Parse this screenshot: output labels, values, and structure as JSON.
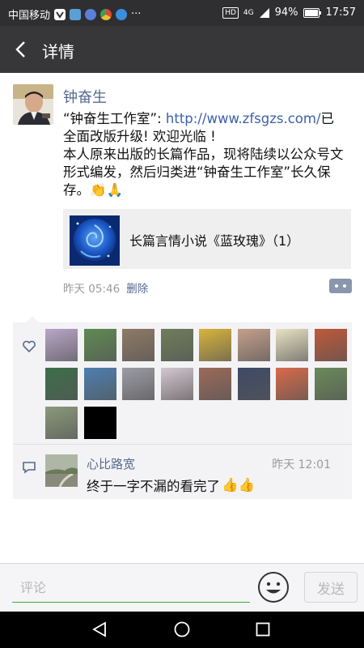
{
  "status_bar": {
    "carrier": "中国移动",
    "more": "···",
    "hd": "HD",
    "network": "4G",
    "battery": "94%",
    "time": "17:57"
  },
  "nav": {
    "title": "详情"
  },
  "post": {
    "author": "钟奋生",
    "text_prefix": "“钟奋生工作室”: ",
    "url": "http://www.zfsgzs.com/",
    "text_line1_suffix": "已全面改版升级! 欢迎光临 !",
    "text_body": "本人原来出版的长篇作品，现将陆续以公众号文形式编发，然后归类进“钟奋生工作室”长久保存。",
    "emojis": "👏🙏",
    "link_card": {
      "title": "长篇言情小说《蓝玫瑰》（1）"
    },
    "time": "昨天 05:46",
    "delete_label": "删除"
  },
  "likes": {
    "count": 18,
    "avatar_colors": [
      "#b9a6c8",
      "#5f8a54",
      "#8f7a66",
      "#6e7e5a",
      "#d9b43c",
      "#c4a08c",
      "#e8e2c4",
      "#c0583a",
      "#3c6e4a",
      "#4d7fb0",
      "#9c9ca4",
      "#d4c8d0",
      "#9c6a5a",
      "#3e4a66",
      "#d86a4a",
      "#6a8a5a",
      "#8a9a7a",
      "#a08068"
    ]
  },
  "comment": {
    "author": "心比路宽",
    "time": "昨天 12:01",
    "text": "终于一字不漏的看完了",
    "emojis": "👍👍"
  },
  "input": {
    "placeholder": "评论",
    "send_label": "发送"
  }
}
